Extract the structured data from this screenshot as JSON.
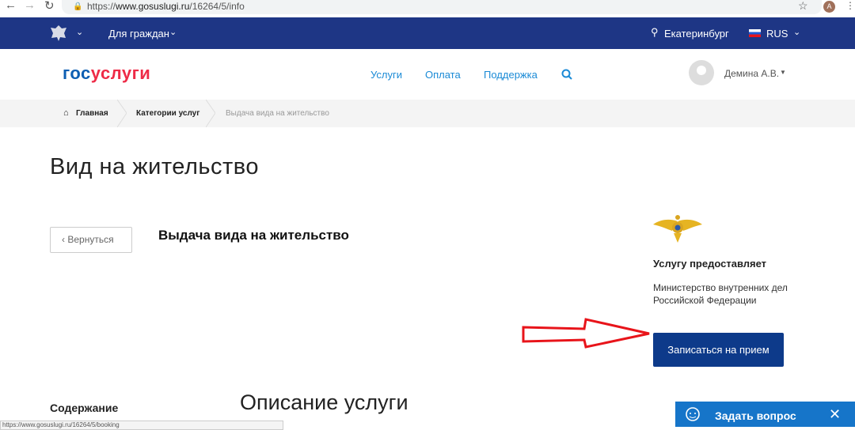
{
  "browser": {
    "url_prefix": "https://",
    "url_host": "www.gosuslugi.ru",
    "url_path": "/16264/5/info",
    "avatar_letter": "A"
  },
  "topbar": {
    "audience": "Для граждан",
    "city": "Екатеринбург",
    "language": "RUS"
  },
  "header": {
    "logo_part1": "гос",
    "logo_part2": "услуги",
    "nav": [
      "Услуги",
      "Оплата",
      "Поддержка"
    ],
    "user": "Демина А.В."
  },
  "breadcrumbs": [
    "Главная",
    "Категории услуг",
    "Выдача вида на жительство"
  ],
  "page": {
    "title": "Вид на жительство",
    "back": "Вернуться",
    "service": "Выдача вида на жительство",
    "provider_label": "Услугу предоставляет",
    "ministry": "Министерство внутренних дел Российской Федерации",
    "book": "Записаться на прием",
    "toc": "Содержание",
    "description": "Описание услуги"
  },
  "status_url": "https://www.gosuslugi.ru/16264/5/booking",
  "chat": {
    "label": "Задать вопрос"
  },
  "colors": {
    "topbar": "#1e3685",
    "button": "#0d3a8a",
    "link": "#1a8ad6",
    "logo_blue": "#0d5fb3",
    "logo_red": "#ee2b47",
    "arrow": "#e8141a"
  }
}
